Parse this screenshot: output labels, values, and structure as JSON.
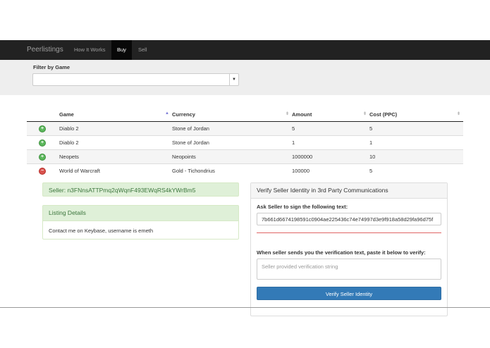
{
  "nav": {
    "brand": "Peerlistings",
    "links": [
      {
        "label": "How It Works"
      },
      {
        "label": "Buy",
        "active": true
      },
      {
        "label": "Sell"
      }
    ]
  },
  "filter": {
    "label": "Filter by Game",
    "selected": ""
  },
  "table": {
    "headers": [
      "Game",
      "Currency",
      "Amount",
      "Cost (PPC)"
    ],
    "rows": [
      {
        "action": "add",
        "game": "Diablo 2",
        "currency": "Stone of Jordan",
        "amount": "5",
        "cost": "5"
      },
      {
        "action": "add",
        "game": "Diablo 2",
        "currency": "Stone of Jordan",
        "amount": "1",
        "cost": "1"
      },
      {
        "action": "add",
        "game": "Neopets",
        "currency": "Neopoints",
        "amount": "1000000",
        "cost": "10"
      },
      {
        "action": "remove",
        "game": "World of Warcraft",
        "currency": "Gold - Tichondrius",
        "amount": "100000",
        "cost": "5"
      }
    ]
  },
  "seller": {
    "label": "Seller: n3FNnsATTPmq2qWqnF493EWqRS4kYWrBm5"
  },
  "listing": {
    "title": "Listing Details",
    "body": "Contact me on Keybase, username is emeth"
  },
  "verify": {
    "title": "Verify Seller Identity in 3rd Party Communications",
    "ask_label": "Ask Seller to sign the following text:",
    "sign_text": "7b661d6674198591c0904ae225436c74e74997d3e9f918a58d29fa96d75f",
    "paste_label": "When seller sends you the verification text, paste it below to verify:",
    "placeholder": "Seller provided verification string",
    "button": "Verify Seller Identity"
  },
  "colors": {
    "navbar": "#222222",
    "success_bg": "#dff0d8",
    "success_text": "#3c763d",
    "primary": "#337ab7",
    "danger": "#d9534f",
    "add": "#5cb85c"
  }
}
